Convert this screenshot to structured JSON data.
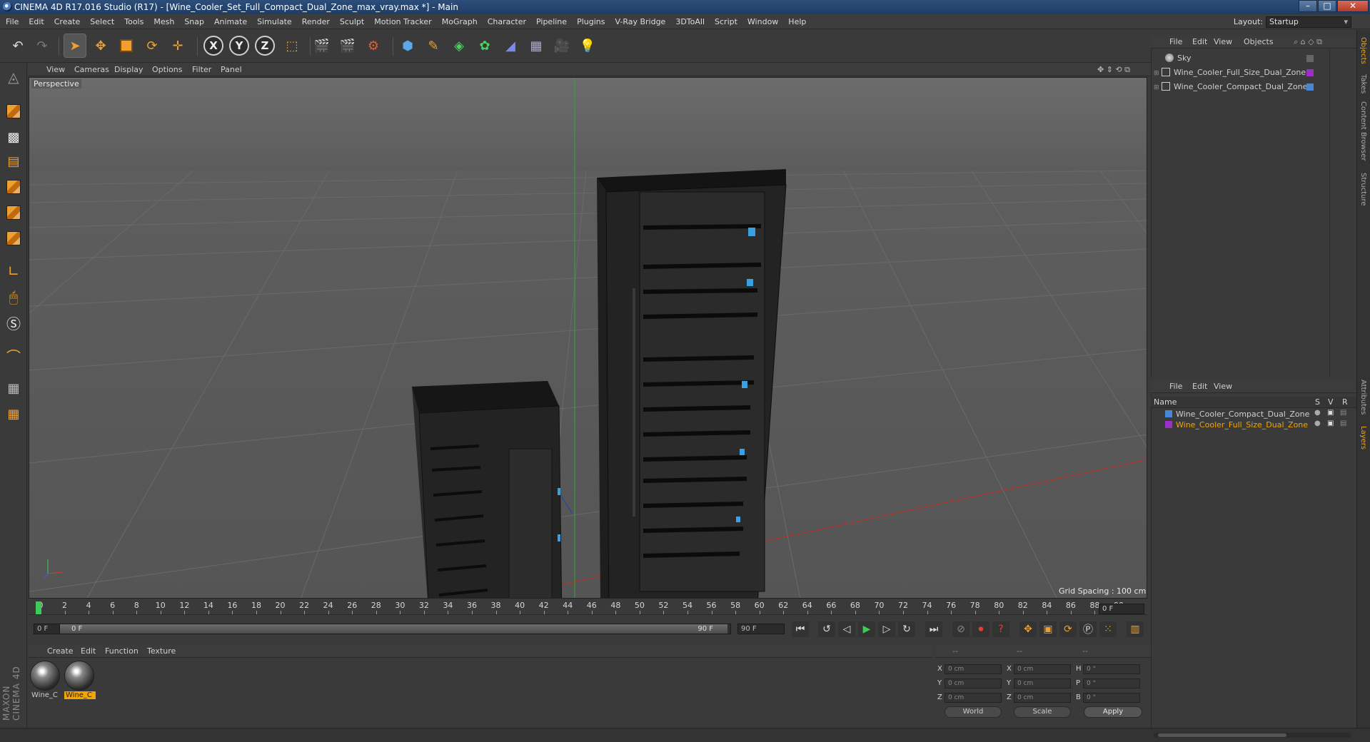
{
  "window": {
    "title": "CINEMA 4D R17.016 Studio (R17) - [Wine_Cooler_Set_Full_Compact_Dual_Zone_max_vray.max *] - Main",
    "minimize": "–",
    "maximize": "□",
    "close": "✕"
  },
  "menu": [
    "File",
    "Edit",
    "Create",
    "Select",
    "Tools",
    "Mesh",
    "Snap",
    "Animate",
    "Simulate",
    "Render",
    "Sculpt",
    "Motion Tracker",
    "MoGraph",
    "Character",
    "Pipeline",
    "Plugins",
    "V-Ray Bridge",
    "3DToAll",
    "Script",
    "Window",
    "Help"
  ],
  "layout": {
    "label": "Layout:",
    "value": "Startup"
  },
  "viewport": {
    "menu": [
      "View",
      "Cameras",
      "Display",
      "Options",
      "Filter",
      "Panel"
    ],
    "camera": "Perspective",
    "grid_spacing": "Grid Spacing : 100 cm"
  },
  "timeline": {
    "ticks": [
      "0",
      "2",
      "4",
      "6",
      "8",
      "10",
      "12",
      "14",
      "16",
      "18",
      "20",
      "22",
      "24",
      "26",
      "28",
      "30",
      "32",
      "34",
      "36",
      "38",
      "40",
      "42",
      "44",
      "46",
      "48",
      "50",
      "52",
      "54",
      "56",
      "58",
      "60",
      "62",
      "64",
      "66",
      "68",
      "70",
      "72",
      "74",
      "76",
      "78",
      "80",
      "82",
      "84",
      "86",
      "88",
      "90"
    ],
    "current_frame": "0 F",
    "start_field": "0 F",
    "range_start": "0 F",
    "range_end": "90 F",
    "end_field": "90 F"
  },
  "materials": {
    "menu": [
      "Create",
      "Edit",
      "Function",
      "Texture"
    ],
    "items": [
      {
        "label": "Wine_C",
        "selected": false
      },
      {
        "label": "Wine_C",
        "selected": true
      }
    ]
  },
  "coords": {
    "header": [
      "--",
      "--",
      "--"
    ],
    "rows": [
      {
        "a": "X",
        "av": "0 cm",
        "b": "X",
        "bv": "0 cm",
        "c": "H",
        "cv": "0 °"
      },
      {
        "a": "Y",
        "av": "0 cm",
        "b": "Y",
        "bv": "0 cm",
        "c": "P",
        "cv": "0 °"
      },
      {
        "a": "Z",
        "av": "0 cm",
        "b": "Z",
        "bv": "0 cm",
        "c": "B",
        "cv": "0 °"
      }
    ],
    "mode": "World",
    "transform": "Scale",
    "apply": "Apply"
  },
  "objects": {
    "menu": [
      "File",
      "Edit",
      "View",
      "Objects"
    ],
    "items": [
      {
        "name": "Sky",
        "color": "#888888"
      },
      {
        "name": "Wine_Cooler_Full_Size_Dual_Zone",
        "color": "#9b2fc8"
      },
      {
        "name": "Wine_Cooler_Compact_Dual_Zone",
        "color": "#4a86d8"
      }
    ]
  },
  "layers": {
    "menu": [
      "File",
      "Edit",
      "View"
    ],
    "columns": {
      "name": "Name",
      "s": "S",
      "v": "V",
      "r": "R"
    },
    "items": [
      {
        "name": "Wine_Cooler_Compact_Dual_Zone",
        "color": "#4a86d8",
        "text_color": "#cfcfcf"
      },
      {
        "name": "Wine_Cooler_Full_Size_Dual_Zone",
        "color": "#9b2fc8",
        "text_color": "#f3a400"
      }
    ]
  },
  "side_tabs": [
    "Objects",
    "Takes",
    "Content Browser",
    "Structure",
    "Attributes",
    "Layers"
  ],
  "brand": "MAXON CINEMA 4D"
}
